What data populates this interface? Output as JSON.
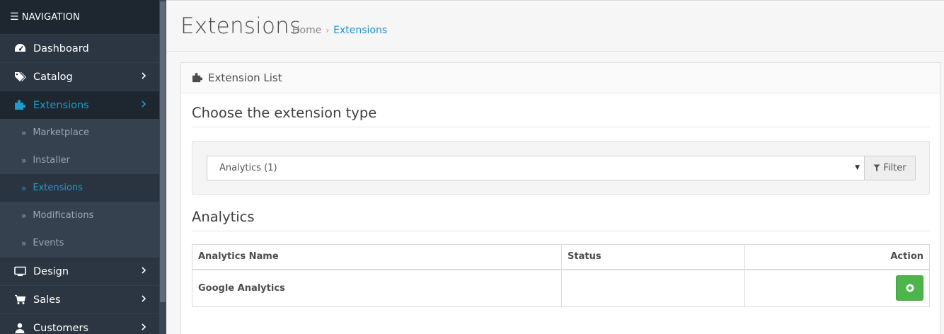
{
  "sidebar": {
    "header": "NAVIGATION",
    "items": [
      {
        "label": "Dashboard",
        "icon": "dashboard-icon",
        "has_children": false
      },
      {
        "label": "Catalog",
        "icon": "tags-icon",
        "has_children": true
      },
      {
        "label": "Extensions",
        "icon": "puzzle-icon",
        "has_children": true,
        "active": true
      },
      {
        "label": "Design",
        "icon": "monitor-icon",
        "has_children": true
      },
      {
        "label": "Sales",
        "icon": "cart-icon",
        "has_children": true
      },
      {
        "label": "Customers",
        "icon": "user-icon",
        "has_children": true
      }
    ],
    "subitems": [
      {
        "label": "Marketplace"
      },
      {
        "label": "Installer"
      },
      {
        "label": "Extensions",
        "active": true
      },
      {
        "label": "Modifications"
      },
      {
        "label": "Events"
      }
    ]
  },
  "header": {
    "title": "Extensions",
    "breadcrumb_home": "Home",
    "breadcrumb_sep": "›",
    "breadcrumb_current": "Extensions"
  },
  "panel": {
    "heading": "Extension List",
    "choose_title": "Choose the extension type",
    "select_value": "Analytics (1)",
    "filter_label": "Filter",
    "section_title": "Analytics",
    "table": {
      "headers": [
        "Analytics Name",
        "Status",
        "Action"
      ],
      "rows": [
        {
          "name": "Google Analytics",
          "status": ""
        }
      ]
    }
  },
  "colors": {
    "sidebar_bg": "#2b3642",
    "accent": "#229ac8",
    "link": "#1e91cf",
    "success": "#4cb64c"
  }
}
